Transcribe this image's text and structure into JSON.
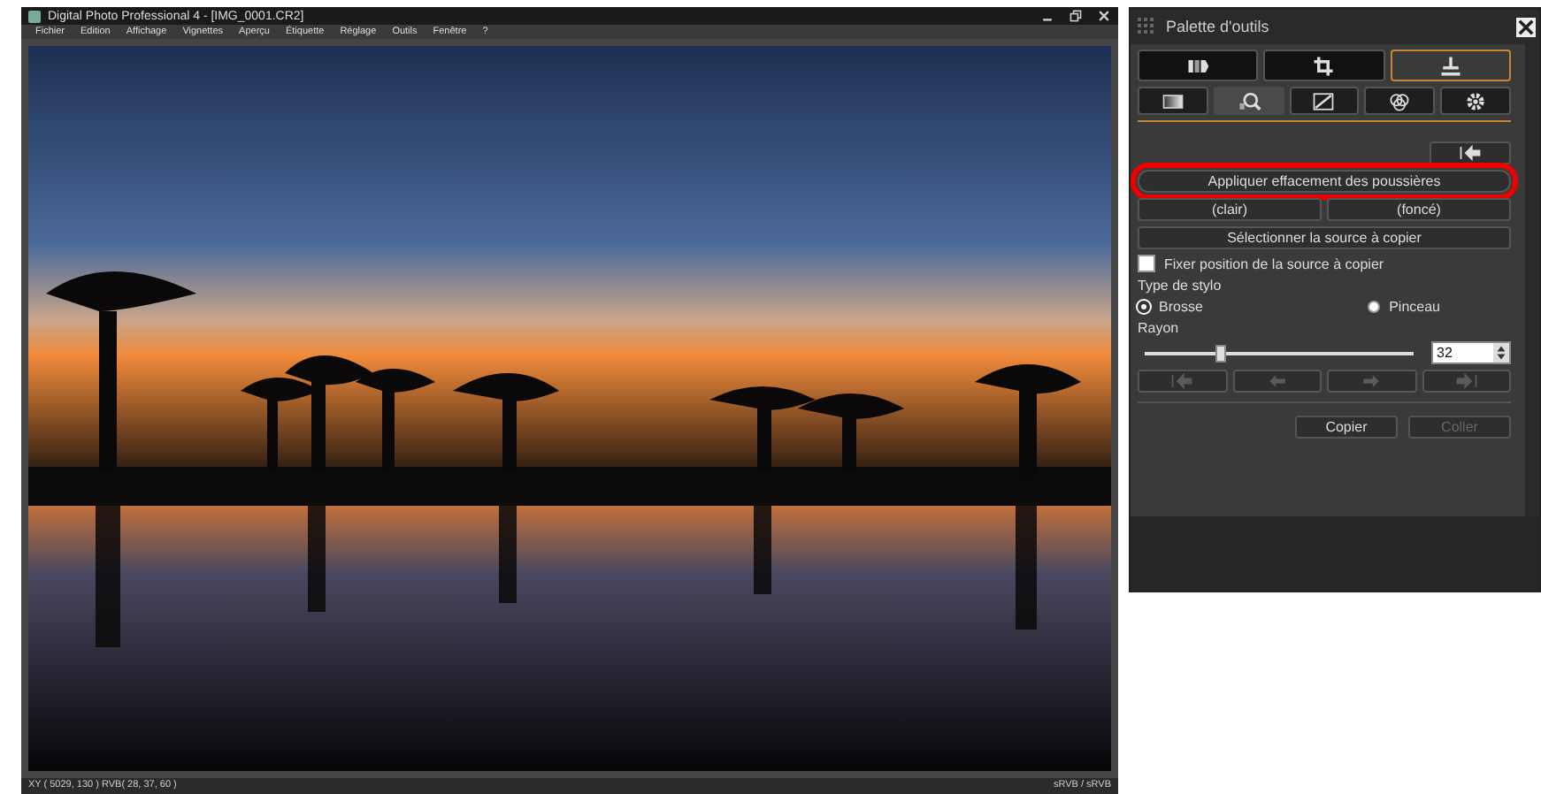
{
  "window": {
    "title": "Digital Photo Professional 4 - [IMG_0001.CR2]"
  },
  "menu": [
    "Fichier",
    "Edition",
    "Affichage",
    "Vignettes",
    "Aperçu",
    "Étiquette",
    "Réglage",
    "Outils",
    "Fenêtre",
    "?"
  ],
  "status_bar": {
    "position": "XY ( 5029, 130 ) RVB( 28, 37, 60 )",
    "profile": "sRVB / sRVB"
  },
  "palette": {
    "title": "Palette d'outils",
    "tool_tabs": [
      {
        "selected": false
      },
      {
        "selected": false
      },
      {
        "selected": true
      }
    ],
    "panel_tabs": [
      {
        "selected": false
      },
      {
        "selected": true
      },
      {
        "selected": false
      },
      {
        "selected": false
      },
      {
        "selected": false
      }
    ],
    "apply_button": {
      "label": "Appliquer effacement des poussières",
      "highlighted": true
    },
    "tone_buttons": [
      "(clair)",
      "(foncé)"
    ],
    "source_button": "Sélectionner la source à copier",
    "fix_position": {
      "label": "Fixer position de la source à copier",
      "checked": false
    },
    "pen_type": {
      "label": "Type de stylo",
      "options": [
        {
          "label": "Brosse",
          "selected": true
        },
        {
          "label": "Pinceau",
          "selected": false
        }
      ]
    },
    "radius": {
      "label": "Rayon",
      "level": 0.28,
      "value": "32"
    },
    "history_buttons": [
      {
        "disabled": true
      },
      {
        "disabled": true
      },
      {
        "disabled": true
      },
      {
        "disabled": true
      }
    ],
    "actions": [
      {
        "label": "Copier",
        "disabled": false
      },
      {
        "label": "Coller",
        "disabled": true
      }
    ]
  }
}
